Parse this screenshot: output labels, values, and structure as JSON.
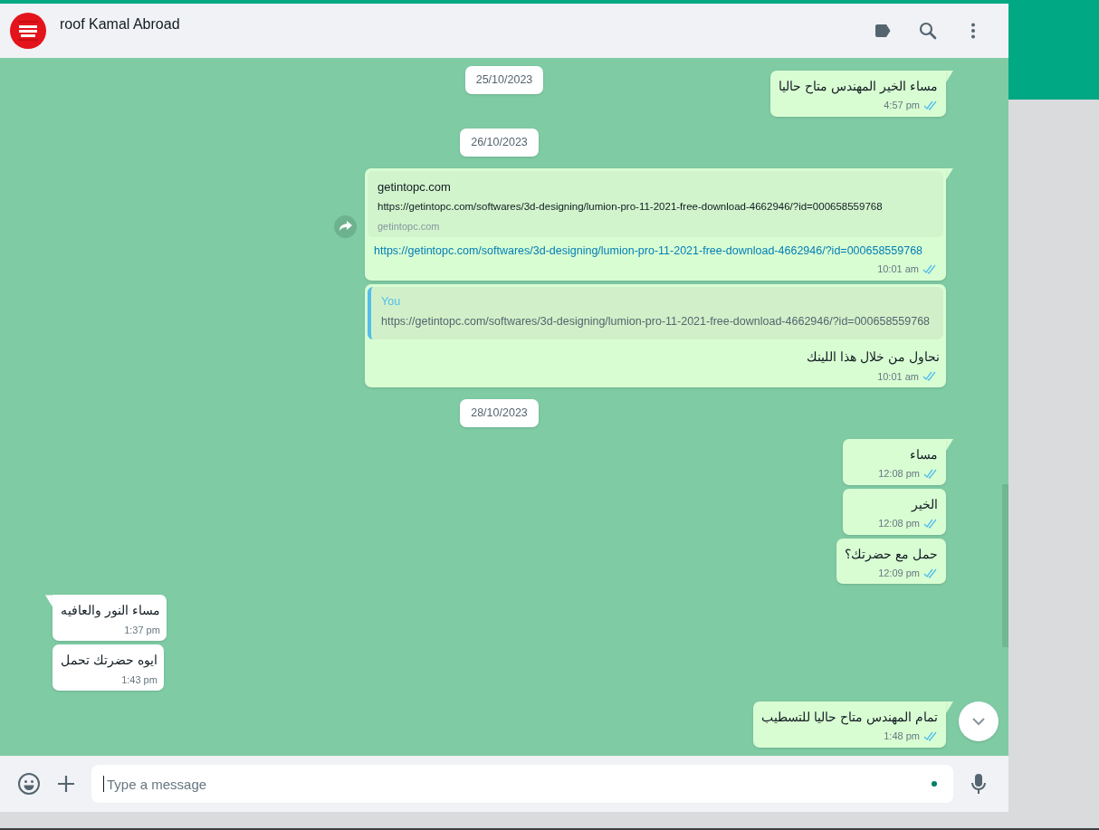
{
  "header": {
    "contact_name": "roof Kamal Abroad"
  },
  "messages": [
    {
      "kind": "date",
      "text": "25/10/2023"
    },
    {
      "kind": "text",
      "outgoing": true,
      "tail": true,
      "text": "مساء الخير المهندس متاح حاليا",
      "time": "4:57 pm",
      "read": true
    },
    {
      "kind": "date",
      "text": "26/10/2023"
    },
    {
      "kind": "link",
      "outgoing": true,
      "tail": true,
      "forward": true,
      "preview_title": "getintopc.com",
      "preview_url": "https://getintopc.com/softwares/3d-designing/lumion-pro-11-2021-free-download-4662946/?id=000658559768",
      "preview_domain": "getintopc.com",
      "text": "https://getintopc.com/softwares/3d-designing/lumion-pro-11-2021-free-download-4662946/?id=000658559768",
      "time": "10:01 am",
      "read": true
    },
    {
      "kind": "reply",
      "outgoing": true,
      "tail": false,
      "quote_author": "You",
      "quote_text": "https://getintopc.com/softwares/3d-designing/lumion-pro-11-2021-free-download-4662946/?id=000658559768",
      "text": "نحاول من خلال هذا اللينك",
      "time": "10:01 am",
      "read": true
    },
    {
      "kind": "date",
      "text": "28/10/2023"
    },
    {
      "kind": "text",
      "outgoing": true,
      "tail": true,
      "text": "مساء",
      "time": "12:08 pm",
      "read": true
    },
    {
      "kind": "text",
      "outgoing": true,
      "tail": false,
      "text": "الخير",
      "time": "12:08 pm",
      "read": true
    },
    {
      "kind": "text",
      "outgoing": true,
      "tail": false,
      "text": "حمل مع حضرتك؟",
      "time": "12:09 pm",
      "read": true
    },
    {
      "kind": "text",
      "outgoing": false,
      "tail": true,
      "text": "مساء النور والعافيه",
      "time": "1:37 pm"
    },
    {
      "kind": "text",
      "outgoing": false,
      "tail": false,
      "text": "ايوه حضرتك تحمل",
      "time": "1:43 pm"
    },
    {
      "kind": "text",
      "outgoing": true,
      "tail": true,
      "text": "تمام المهندس متاح حاليا للتسطيب",
      "time": "1:48 pm",
      "read": true
    }
  ],
  "composer": {
    "placeholder": "Type a message"
  }
}
